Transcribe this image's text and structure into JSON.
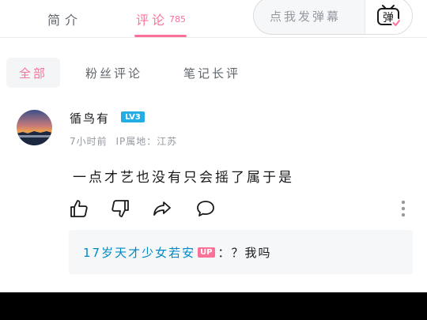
{
  "tabs": {
    "intro_label": "简介",
    "comments_label": "评论",
    "comments_count": "785"
  },
  "danmaku": {
    "placeholder": "点我发弹幕",
    "button_label": "弹"
  },
  "filters": {
    "all": "全部",
    "fans": "粉丝评论",
    "long": "笔记长评"
  },
  "comment": {
    "username": "循鸟有",
    "level": "LV3",
    "time": "7小时前",
    "ip_location": "IP属地：江苏",
    "content": "一点才艺也没有只会摇了属于是",
    "reply": {
      "user": "17岁天才少女若安",
      "up_badge": "UP",
      "text": "：？我吗"
    }
  },
  "colors": {
    "accent": "#fb7299",
    "link": "#008ac5",
    "level": "#23ade5"
  }
}
